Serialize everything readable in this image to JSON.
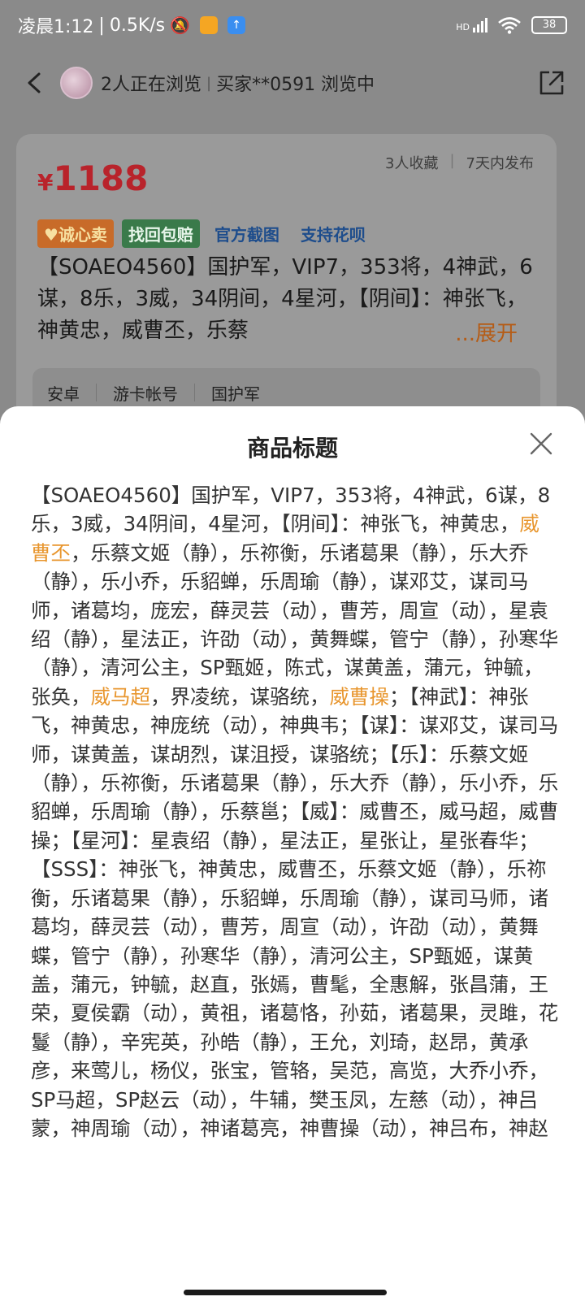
{
  "status_bar": {
    "time": "凌晨1:12",
    "net_speed": "0.5K/s",
    "signal_label": "HD",
    "battery": "38"
  },
  "header": {
    "viewers": "2人正在浏览",
    "buyer": "买家**0591 浏览中"
  },
  "product": {
    "currency": "¥",
    "price": "1188",
    "favorites": "3人收藏",
    "published": "7天内发布",
    "tags": [
      "诚心卖",
      "找回包赔",
      "官方截图",
      "支持花呗"
    ],
    "title_preview": "【SOAEO4560】国护军，VIP7，353将，4神武，6谋，8乐，3威，34阴间，4星河，【阴间】：神张飞，神黄忠，威曹丕，乐蔡",
    "expand_label": "...展开",
    "attributes": [
      "安卓",
      "游卡帐号",
      "国护军"
    ]
  },
  "sheet": {
    "title": "商品标题",
    "segments": [
      {
        "text": "【SOAEO4560】国护军，VIP7，353将，4神武，6谋，8乐，3威，34阴间，4星河，【阴间】：神张飞，神黄忠，",
        "highlight": false
      },
      {
        "text": "威曹丕",
        "highlight": true
      },
      {
        "text": "，乐蔡文姬（静），乐祢衡，乐诸葛果（静），乐大乔（静），乐小乔，乐貂蝉，乐周瑜（静），谋邓艾，谋司马师，诸葛均，庞宏，薛灵芸（动），曹芳，周宣（动），星袁绍（静），星法正，许劭（动），黄舞蝶，管宁（静），孙寒华（静），清河公主，SP甄姬，陈式，谋黄盖，蒲元，钟毓，张奂，",
        "highlight": false
      },
      {
        "text": "威马超",
        "highlight": true
      },
      {
        "text": "，界凌统，谋骆统，",
        "highlight": false
      },
      {
        "text": "威曹操",
        "highlight": true
      },
      {
        "text": "；【神武】：神张飞，神黄忠，神庞统（动），神典韦；【谋】：谋邓艾，谋司马师，谋黄盖，谋胡烈，谋沮授，谋骆统；【乐】：乐蔡文姬（静），乐祢衡，乐诸葛果（静），乐大乔（静），乐小乔，乐貂蝉，乐周瑜（静），乐蔡邕；【威】：威曹丕，威马超，威曹操；【星河】：星袁绍（静），星法正，星张让，星张春华；【SSS】：神张飞，神黄忠，威曹丕，乐蔡文姬（静），乐祢衡，乐诸葛果（静），乐貂蝉，乐周瑜（静），谋司马师，诸葛均，薛灵芸（动），曹芳，周宣（动），许劭（动），黄舞蝶，管宁（静），孙寒华（静），清河公主，SP甄姬，谋黄盖，蒲元，钟毓，赵直，张嫣，曹髦，全惠解，张昌蒲，王荣，夏侯霸（动），黄祖，诸葛恪，孙茹，诸葛果，灵雎，花鬘（静），辛宪英，孙皓（静），王允，刘琦，赵昂，黄承彦，来莺儿，杨仪，张宝，管辂，吴范，高览，大乔小乔，SP马超，SP赵云（动），牛辅，樊玉凤，左慈（动），神吕蒙，神周瑜（动），神诸葛亮，神曹操（动），神吕布，神赵",
        "highlight": false
      }
    ]
  }
}
